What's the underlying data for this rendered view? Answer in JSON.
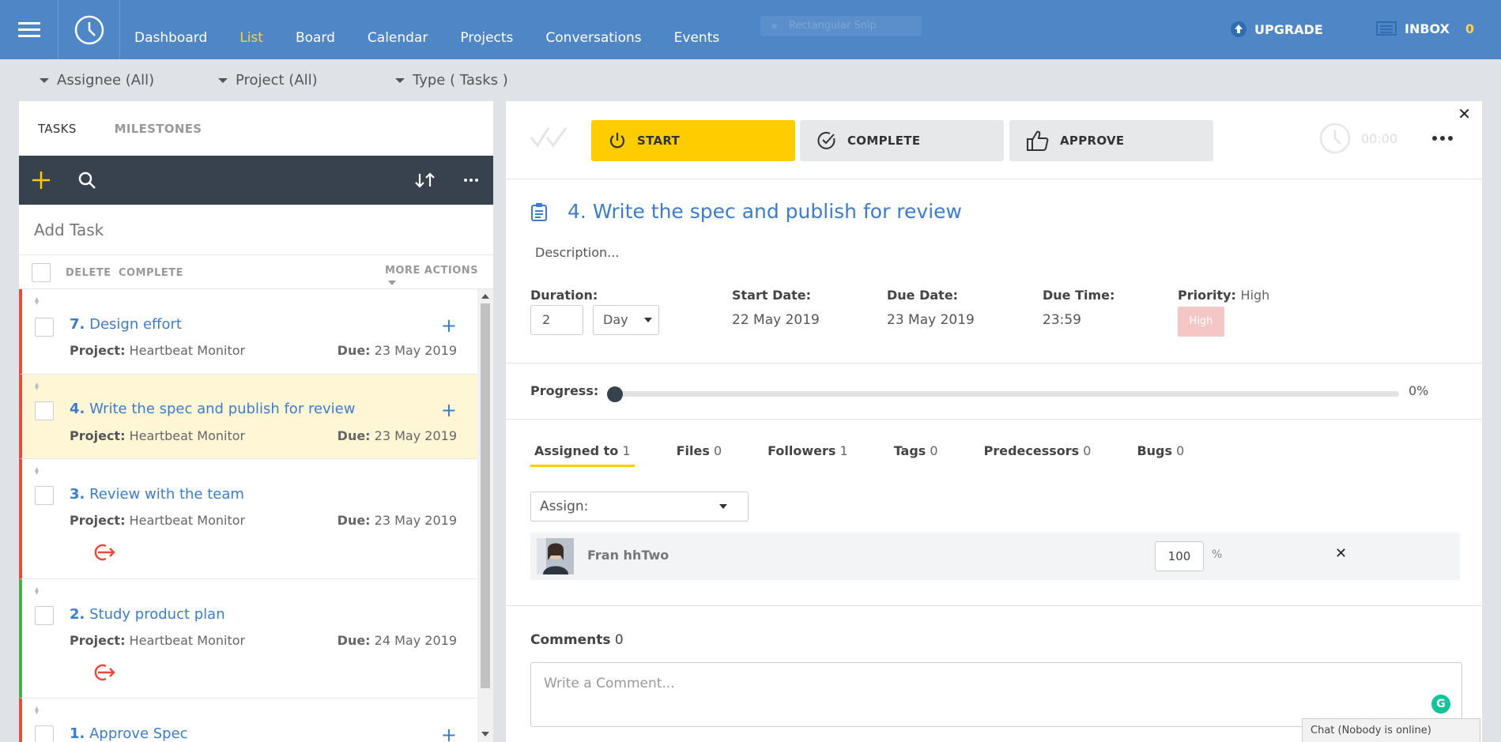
{
  "nav": {
    "items": [
      "Dashboard",
      "List",
      "Board",
      "Calendar",
      "Projects",
      "Conversations",
      "Events"
    ],
    "active": "List",
    "snip_overlay": "Rectangular Snip",
    "upgrade_label": "UPGRADE",
    "inbox_label": "INBOX",
    "inbox_count": "0"
  },
  "filters": {
    "assignee": "Assignee (All)",
    "project": "Project (All)",
    "type": "Type ( Tasks )"
  },
  "left": {
    "tabs": [
      "TASKS",
      "MILESTONES"
    ],
    "add_task_placeholder": "Add Task",
    "bulk": {
      "delete": "DELETE",
      "complete": "COMPLETE",
      "more": "MORE ACTIONS"
    },
    "project_label": "Project:",
    "due_label": "Due:",
    "tasks": [
      {
        "num": "7.",
        "title": "Design effort",
        "project": "Heartbeat Monitor",
        "due": "23 May 2019"
      },
      {
        "num": "4.",
        "title": "Write the spec and publish for review",
        "project": "Heartbeat Monitor",
        "due": "23 May 2019"
      },
      {
        "num": "3.",
        "title": "Review with the team",
        "project": "Heartbeat Monitor",
        "due": "23 May 2019"
      },
      {
        "num": "2.",
        "title": "Study product plan",
        "project": "Heartbeat Monitor",
        "due": "24 May 2019"
      },
      {
        "num": "1.",
        "title": "Approve Spec"
      }
    ]
  },
  "detail": {
    "buttons": {
      "start": "START",
      "complete": "COMPLETE",
      "approve": "APPROVE"
    },
    "timer": "00:00",
    "number": "4.",
    "title": "Write the spec and publish for review",
    "description": "Description...",
    "duration_label": "Duration:",
    "duration_value": "2",
    "duration_unit": "Day",
    "start_label": "Start Date:",
    "start_value": "22 May 2019",
    "due_label": "Due Date:",
    "due_value": "23 May 2019",
    "time_label": "Due Time:",
    "time_value": "23:59",
    "priority_label": "Priority:",
    "priority_value": "High",
    "priority_badge": "High",
    "progress_label": "Progress:",
    "progress_value": 0,
    "progress_text": "0%",
    "subtabs": [
      {
        "label": "Assigned to",
        "count": "1"
      },
      {
        "label": "Files",
        "count": "0"
      },
      {
        "label": "Followers",
        "count": "1"
      },
      {
        "label": "Tags",
        "count": "0"
      },
      {
        "label": "Predecessors",
        "count": "0"
      },
      {
        "label": "Bugs",
        "count": "0"
      }
    ],
    "assign_placeholder": "Assign:",
    "assignee_name": "Fran hhTwo",
    "assignee_pct": "100",
    "pct_sign": "%",
    "comments_label": "Comments",
    "comments_count": "0",
    "comment_placeholder": "Write a Comment..."
  },
  "chat": {
    "label": "Chat (Nobody is online)"
  },
  "colors": {
    "nav_bg": "#4f86c6",
    "accent": "#ffcc00",
    "link": "#3d7cc9",
    "toolbar": "#37424e"
  }
}
